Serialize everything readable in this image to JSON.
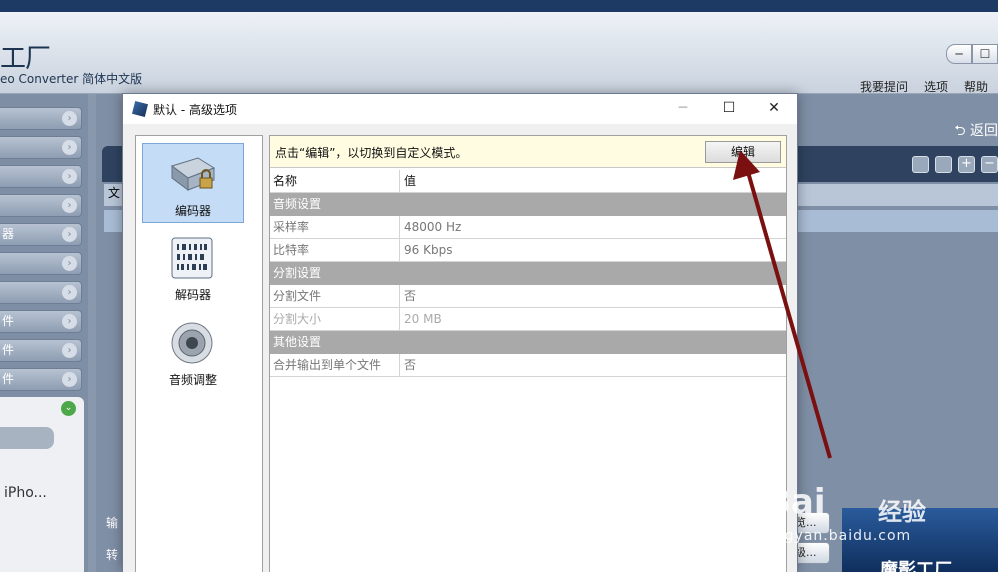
{
  "app": {
    "logo_text": "工厂",
    "subtitle": "eo Converter 简体中文版",
    "menu": [
      "我要提问",
      "选项",
      "帮助"
    ],
    "back_label": "返回",
    "output_label": "输",
    "convert_label": "转",
    "sidebar_partial": [
      "",
      "",
      "",
      "",
      "器",
      "",
      "",
      "件",
      "件",
      "件"
    ],
    "device_label": "iPho...",
    "list_header_partial": "文",
    "small_buttons": [
      "览...",
      "级..."
    ],
    "banner_text": "魔影工厂",
    "icon_bar": [
      "settings-icon",
      "gear-icon",
      "plus-icon",
      "minus-icon"
    ]
  },
  "dialog": {
    "title": "默认 - 高级选项",
    "controls": {
      "minimize": "─",
      "maximize": "☐",
      "close": "✕"
    },
    "categories": [
      {
        "label": "编码器",
        "icon": "encoder-icon",
        "selected": true
      },
      {
        "label": "解码器",
        "icon": "decoder-icon",
        "selected": false
      },
      {
        "label": "音频调整",
        "icon": "speaker-icon",
        "selected": false
      }
    ],
    "hint": "点击“编辑”，以切换到自定义模式。",
    "edit_button": "编辑",
    "table": {
      "headers": [
        "名称",
        "值"
      ],
      "rows": [
        {
          "type": "group",
          "name": "音频设置"
        },
        {
          "type": "item",
          "name": "采样率",
          "value": "48000 Hz"
        },
        {
          "type": "item",
          "name": "比特率",
          "value": "96 Kbps"
        },
        {
          "type": "group",
          "name": "分割设置"
        },
        {
          "type": "item",
          "name": "分割文件",
          "value": "否"
        },
        {
          "type": "item",
          "name": "分割大小",
          "value": "20 MB",
          "disabled": true
        },
        {
          "type": "group",
          "name": "其他设置"
        },
        {
          "type": "item",
          "name": "合并输出到单个文件",
          "value": "否"
        }
      ]
    }
  },
  "watermark": {
    "brand": "Bai",
    "brand_suffix": "经验",
    "url": "jingyan.baidu.com"
  },
  "colors": {
    "arrow": "#7a1010",
    "group_row": "#a9a9a9",
    "selected_category": "#c5dcf6",
    "hint_bg": "#fffce1"
  }
}
